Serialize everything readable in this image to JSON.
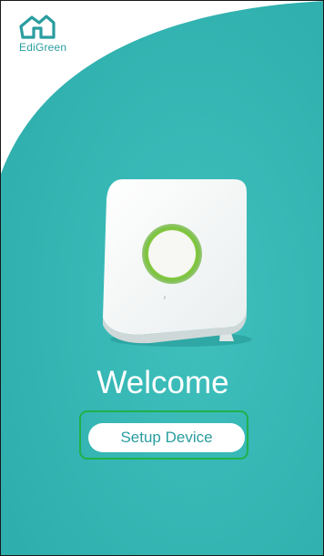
{
  "app": {
    "logo_text": "EdiGreen",
    "logo_icon": "house-icon"
  },
  "main": {
    "device_image": "sensor-device-illustration",
    "welcome_text": "Welcome",
    "setup_button_label": "Setup Device"
  },
  "colors": {
    "teal_background": "#35b8b6",
    "teal_text": "#2a9da0",
    "button_background": "#ffffff",
    "highlight_outline": "#21b04a",
    "device_glow": "#8fd13f"
  }
}
